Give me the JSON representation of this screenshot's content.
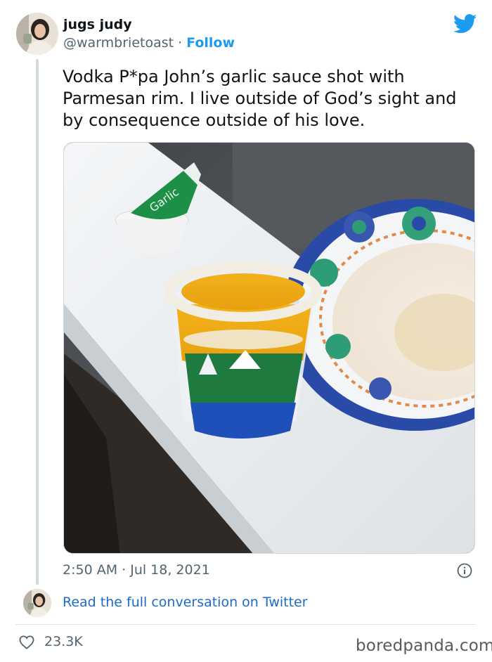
{
  "author": {
    "display_name": "jugs judy",
    "handle": "@warmbrietoast",
    "separator": "·",
    "follow_label": "Follow"
  },
  "tweet": {
    "text": "Vodka P*pa John’s garlic sauce shot with Parmesan rim. I live outside of God’s sight and by consequence outside of his love.",
    "timestamp": "2:50 AM · Jul 18, 2021"
  },
  "media": {
    "sauce_cup_label": "Garlic"
  },
  "footer": {
    "read_conversation_label": "Read the full conversation on Twitter",
    "like_count": "23.3K"
  },
  "watermark": "boredpanda.com",
  "colors": {
    "accent": "#1d9bf0",
    "text_primary": "#0f1419",
    "text_secondary": "#536471",
    "link": "#1d6bc8"
  },
  "icons": [
    "twitter-bird-icon",
    "info-icon",
    "heart-icon"
  ]
}
